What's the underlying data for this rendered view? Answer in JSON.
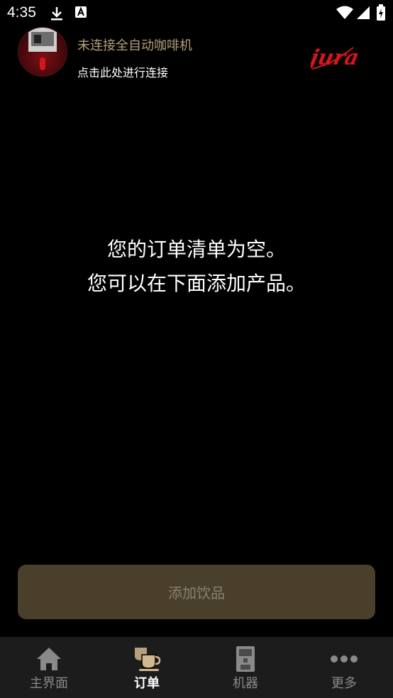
{
  "status_bar": {
    "time": "4:35"
  },
  "header": {
    "connection_title": "未连接全自动咖啡机",
    "connection_subtitle": "点击此处进行连接",
    "brand": "jura"
  },
  "main": {
    "empty_line1": "您的订单清单为空。",
    "empty_line2": "您可以在下面添加产品。",
    "add_button_label": "添加饮品"
  },
  "bottom_nav": {
    "items": [
      {
        "label": "主界面",
        "icon": "home-icon",
        "active": false
      },
      {
        "label": "订单",
        "icon": "coffee-cups-icon",
        "active": true
      },
      {
        "label": "机器",
        "icon": "coffee-machine-icon",
        "active": false
      },
      {
        "label": "更多",
        "icon": "more-dots-icon",
        "active": false
      }
    ]
  },
  "colors": {
    "accent": "#b59f7c",
    "button_bg": "#4a3f2a",
    "button_text": "#8a8272",
    "brand_red": "#d8141d",
    "nav_bg": "#1c1c1c"
  }
}
